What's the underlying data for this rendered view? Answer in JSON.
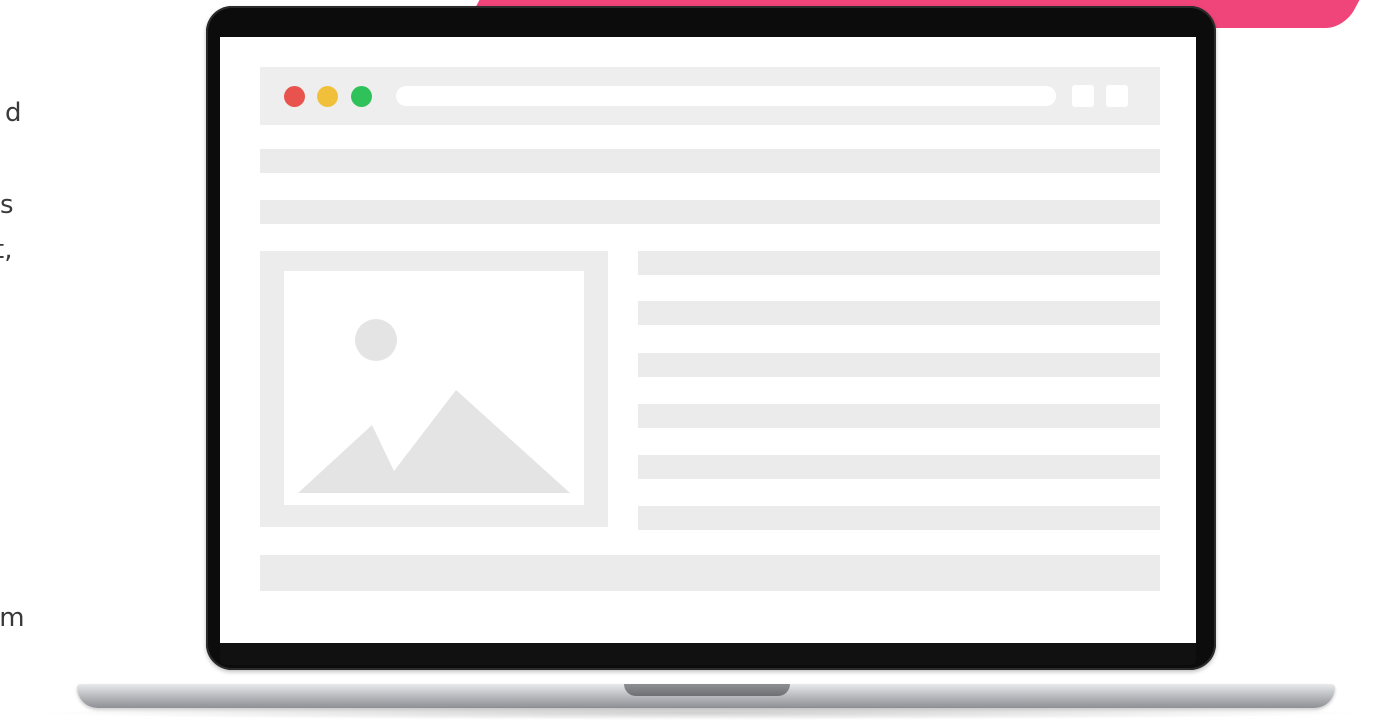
{
  "left_fragments": [
    "d",
    "s",
    "t,",
    "ım"
  ],
  "colors": {
    "accent_pink": "#f0457a",
    "dot_red": "#e8534e",
    "dot_yellow": "#f1c03b",
    "dot_green": "#2fc25a",
    "wireframe_gray": "#ebebeb"
  },
  "icons": {
    "close_dot": "red-circle",
    "minimize_dot": "yellow-circle",
    "maximize_dot": "green-circle",
    "image_placeholder": "image-mountain-sun-icon"
  }
}
